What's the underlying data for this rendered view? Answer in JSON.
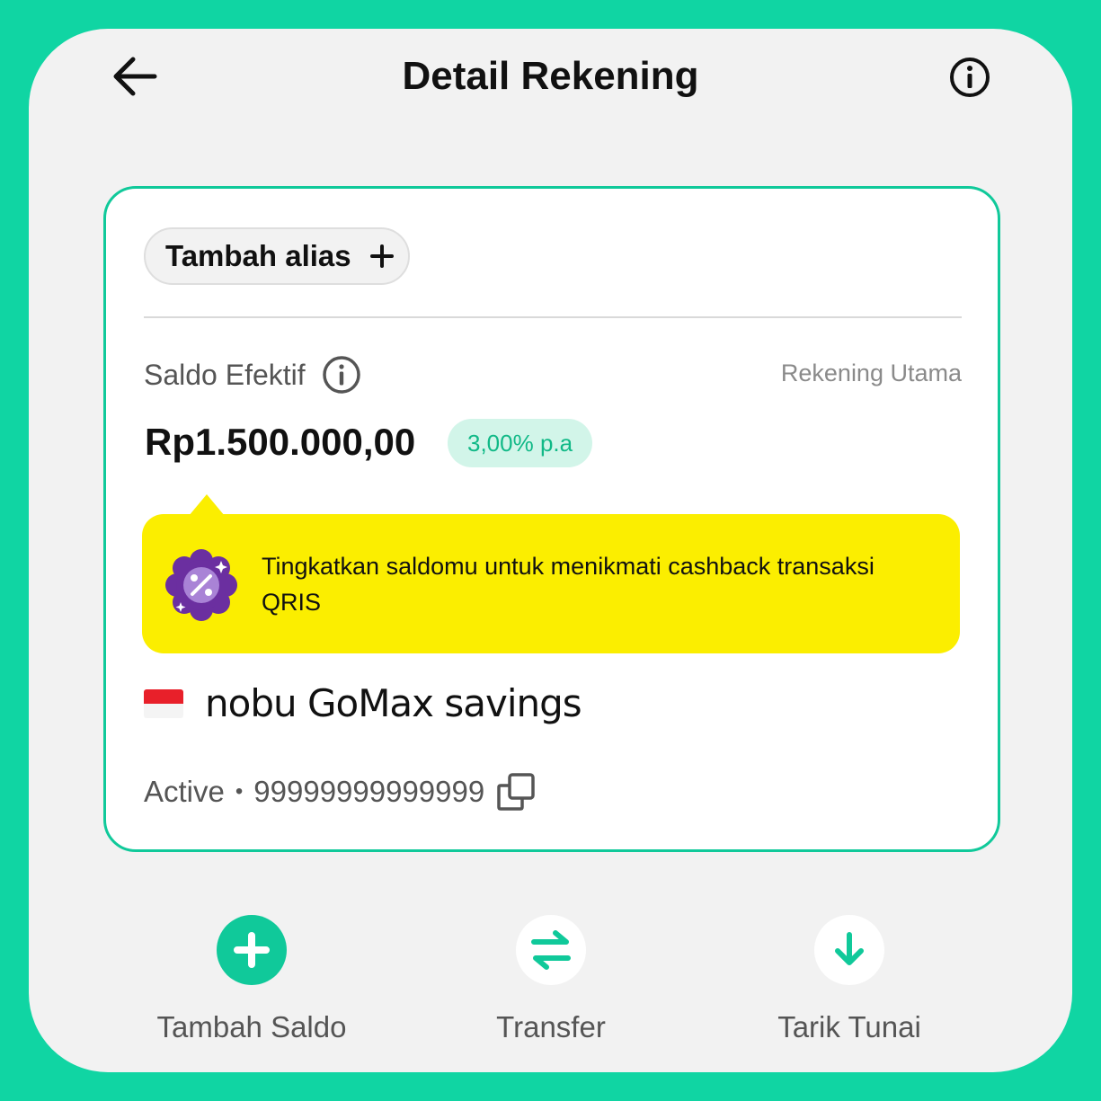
{
  "header": {
    "title": "Detail Rekening",
    "back_icon": "arrow-left-icon",
    "info_icon": "info-circle-icon"
  },
  "card": {
    "alias_button_label": "Tambah alias",
    "saldo_label": "Saldo Efektif",
    "account_type": "Rekening Utama",
    "balance": "Rp1.500.000,00",
    "rate": "3,00% p.a",
    "promo_text": "Tingkatkan saldomu untuk menikmati cashback transaksi QRIS",
    "product_name": "nobu GoMax savings",
    "status": "Active",
    "account_number": "99999999999999"
  },
  "actions": [
    {
      "label": "Tambah Saldo",
      "icon": "plus-circle-icon"
    },
    {
      "label": "Transfer",
      "icon": "transfer-arrows-icon"
    },
    {
      "label": "Tarik Tunai",
      "icon": "arrow-down-icon"
    }
  ],
  "colors": {
    "accent": "#10d5a3",
    "promo_bg": "#fbee00",
    "rate_text": "#11b987",
    "rate_bg": "#d2f5e9"
  }
}
